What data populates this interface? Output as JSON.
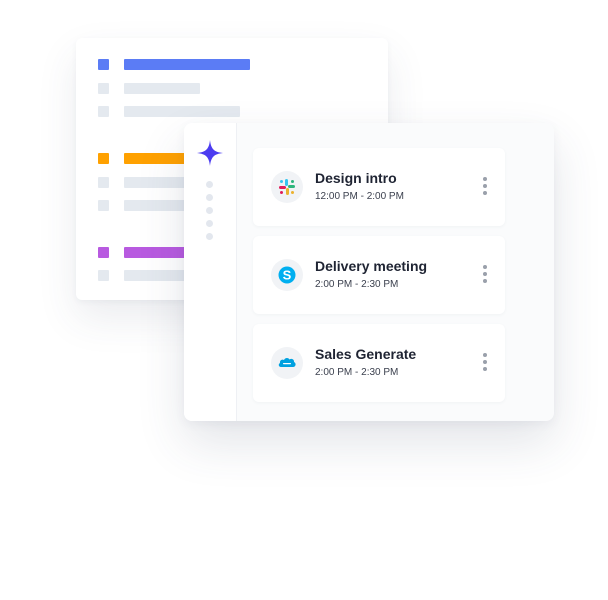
{
  "colors": {
    "accent": "#5b7cf5",
    "orange": "#ffa100",
    "purple": "#b85ae0",
    "placeholder": "#e4e9ef",
    "sparkle": "#4c3cf0"
  },
  "list_card": {
    "groups": [
      {
        "accent": "#5b7cf5"
      },
      {
        "accent": "#ffa100"
      },
      {
        "accent": "#b85ae0"
      }
    ]
  },
  "events": [
    {
      "title": "Design intro",
      "time": "12:00 PM - 2:00 PM",
      "icon": "slack-icon"
    },
    {
      "title": "Delivery meeting",
      "time": "2:00 PM - 2:30 PM",
      "icon": "skype-icon"
    },
    {
      "title": "Sales Generate",
      "time": "2:00 PM - 2:30 PM",
      "icon": "salesforce-icon"
    }
  ]
}
